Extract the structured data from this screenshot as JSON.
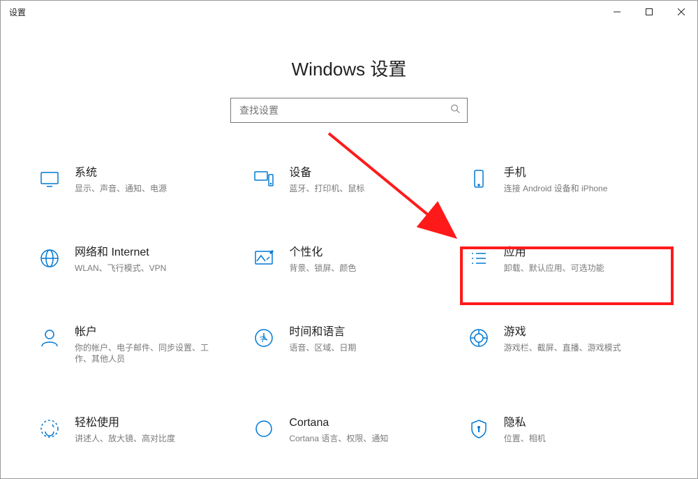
{
  "window": {
    "title": "设置"
  },
  "page": {
    "heading": "Windows 设置"
  },
  "search": {
    "placeholder": "查找设置"
  },
  "categories": [
    {
      "id": "system",
      "title": "系统",
      "desc": "显示、声音、通知、电源"
    },
    {
      "id": "devices",
      "title": "设备",
      "desc": "蓝牙、打印机、鼠标"
    },
    {
      "id": "phone",
      "title": "手机",
      "desc": "连接 Android 设备和 iPhone"
    },
    {
      "id": "network",
      "title": "网络和 Internet",
      "desc": "WLAN、飞行模式、VPN"
    },
    {
      "id": "personalization",
      "title": "个性化",
      "desc": "背景、锁屏、颜色"
    },
    {
      "id": "apps",
      "title": "应用",
      "desc": "卸载、默认应用、可选功能"
    },
    {
      "id": "accounts",
      "title": "帐户",
      "desc": "你的帐户、电子邮件、同步设置、工作、其他人员"
    },
    {
      "id": "time",
      "title": "时间和语言",
      "desc": "语音、区域、日期"
    },
    {
      "id": "gaming",
      "title": "游戏",
      "desc": "游戏栏、截屏、直播、游戏模式"
    },
    {
      "id": "ease",
      "title": "轻松使用",
      "desc": "讲述人、放大镜、高对比度"
    },
    {
      "id": "cortana",
      "title": "Cortana",
      "desc": "Cortana 语言、权限、通知"
    },
    {
      "id": "privacy",
      "title": "隐私",
      "desc": "位置、相机"
    }
  ],
  "annotation": {
    "highlighted_id": "apps"
  }
}
